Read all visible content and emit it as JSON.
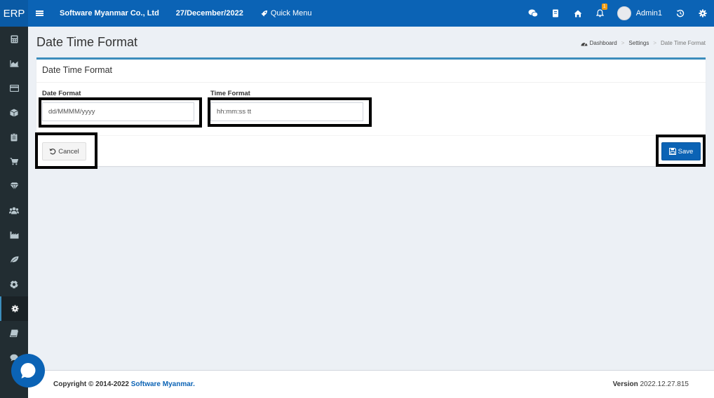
{
  "app": {
    "logo": "ERP"
  },
  "topbar": {
    "company": "Software Myanmar Co., Ltd",
    "date": "27/December/2022",
    "quick_menu": "Quick Menu",
    "notification_count": "1",
    "user": "Admin1"
  },
  "sidebar": {
    "items": [
      {
        "icon": "calculator-icon"
      },
      {
        "icon": "area-chart-icon"
      },
      {
        "icon": "credit-card-icon"
      },
      {
        "icon": "cube-icon"
      },
      {
        "icon": "clipboard-icon"
      },
      {
        "icon": "cart-icon"
      },
      {
        "icon": "diamond-icon"
      },
      {
        "icon": "users-icon"
      },
      {
        "icon": "industry-icon"
      },
      {
        "icon": "leaf-icon"
      },
      {
        "icon": "soccer-ball-icon"
      },
      {
        "icon": "gear-icon",
        "active": true
      },
      {
        "icon": "book-icon"
      },
      {
        "icon": "comment-icon"
      }
    ]
  },
  "page": {
    "title": "Date Time Format",
    "breadcrumb": {
      "home": "Dashboard",
      "parent": "Settings",
      "current": "Date Time Format"
    }
  },
  "form": {
    "box_title": "Date Time Format",
    "date_label": "Date Format",
    "date_value": "dd/MMMM/yyyy",
    "time_label": "Time Format",
    "time_value": "hh:mm:ss tt",
    "cancel_label": "Cancel",
    "save_label": "Save"
  },
  "footer": {
    "copyright": "Copyright © 2014-2022",
    "company_link": "Software Myanmar.",
    "version_label": "Version",
    "version_number": "2022.12.27.815"
  },
  "colors": {
    "primary": "#0b63b5",
    "sidebar": "#222d32",
    "background": "#ecf0f5"
  }
}
